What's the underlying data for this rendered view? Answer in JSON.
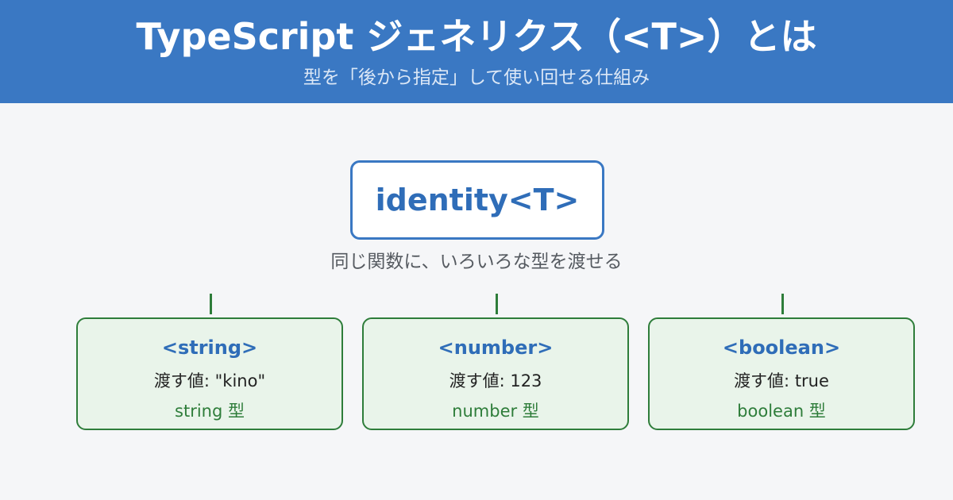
{
  "header": {
    "title": "TypeScript ジェネリクス（<T>）とは",
    "subtitle": "型を「後から指定」して使い回せる仕組み"
  },
  "root": {
    "label": "identity<T>",
    "caption": "同じ関数に、いろいろな型を渡せる"
  },
  "cards": [
    {
      "type": "<string>",
      "value": "渡す値: \"kino\"",
      "result": "string 型"
    },
    {
      "type": "<number>",
      "value": "渡す値: 123",
      "result": "number 型"
    },
    {
      "type": "<boolean>",
      "value": "渡す値: true",
      "result": "boolean 型"
    }
  ],
  "colors": {
    "header_bg": "#3a78c3",
    "accent_blue": "#2f6db8",
    "accent_green": "#2e7d3a",
    "card_bg": "#e9f4ea",
    "page_bg": "#f5f6f8"
  }
}
